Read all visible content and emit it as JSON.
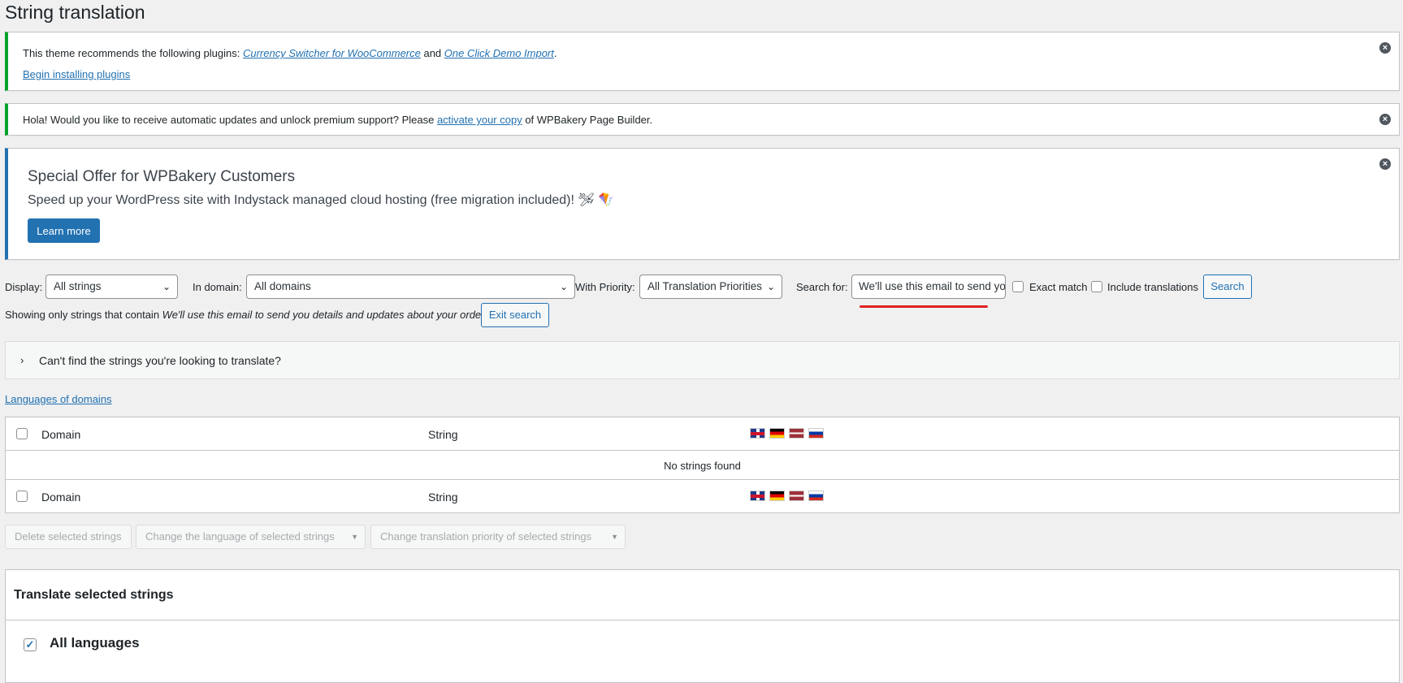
{
  "page": {
    "title": "String translation"
  },
  "notices": {
    "plugins": {
      "text_before": "This theme recommends the following plugins: ",
      "plugin1": "Currency Switcher for WooCommerce",
      "and": " and ",
      "plugin2": "One Click Demo Import",
      "period": ".",
      "install_link": "Begin installing plugins"
    },
    "wpbakery": {
      "text_before": "Hola! Would you like to receive automatic updates and unlock premium support? Please ",
      "link": "activate your copy",
      "text_after": " of WPBakery Page Builder."
    },
    "offer": {
      "title": "Special Offer for WPBakery Customers",
      "subtitle": "Speed up your WordPress site with Indystack managed cloud hosting (free migration included)! 🛩 🪁",
      "button": "Learn more"
    },
    "dismiss_glyph": "×"
  },
  "filters": {
    "display_label": "Display:",
    "display_value": "All strings",
    "domain_label": "In domain:",
    "domain_value": "All domains",
    "priority_label": "With Priority:",
    "priority_value": "All Translation Priorities",
    "search_label": "Search for:",
    "search_value": "We'll use this email to send you details and updates about your order.",
    "exact_match": "Exact match",
    "include_translations": "Include translations",
    "search_button": "Search",
    "chevron": "⌄"
  },
  "showing": {
    "prefix": "Showing only strings that contain ",
    "query": "We'll use this email to send you details and updates about your order.",
    "exit_button": "Exit search"
  },
  "help_panel": {
    "chevron": "›",
    "text": "Can't find the strings you're looking to translate?"
  },
  "languages_link": "Languages of domains",
  "table": {
    "col_domain": "Domain",
    "col_string": "String",
    "empty": "No strings found",
    "flags": [
      "uk",
      "de",
      "lv",
      "ru"
    ]
  },
  "bulk": {
    "delete": "Delete selected strings",
    "change_language": "Change the language of selected strings",
    "change_priority": "Change translation priority of selected strings",
    "arrow": "▼"
  },
  "translate": {
    "title": "Translate selected strings",
    "all_languages": "All languages",
    "check": "✓"
  }
}
